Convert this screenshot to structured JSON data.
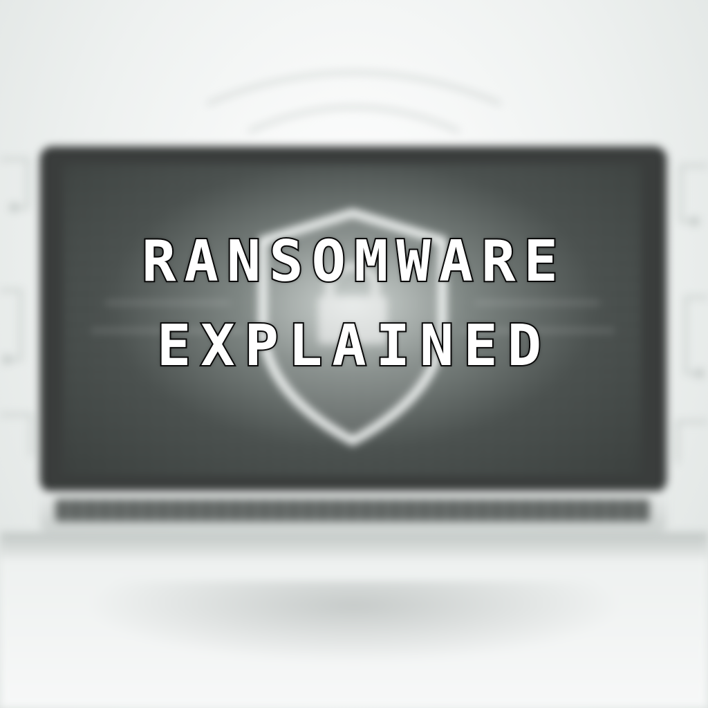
{
  "title": {
    "line1": "RANSOMWARE",
    "line2": "EXPLAINED"
  },
  "icons": {
    "shield": "shield-icon"
  },
  "colors": {
    "title_fill": "#ffffff",
    "title_outline": "#0a0a0a",
    "screen_dark": "#3a3d3c",
    "background": "#f2f4f3"
  }
}
